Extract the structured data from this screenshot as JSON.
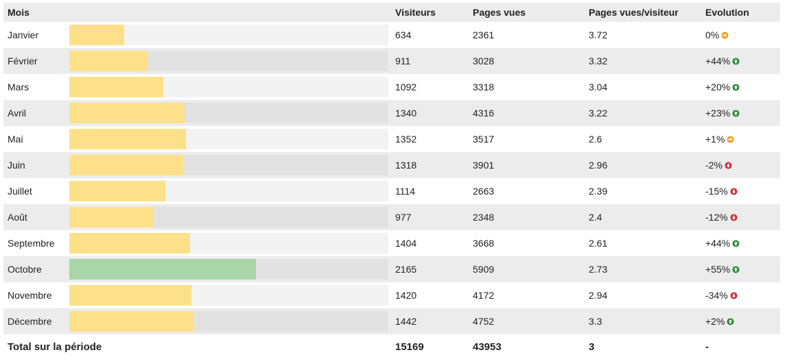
{
  "table": {
    "headers": {
      "month": "Mois",
      "visitors": "Visiteurs",
      "pages": "Pages vues",
      "pages_per_visitor": "Pages vues/visiteur",
      "evolution": "Evolution"
    },
    "rows": [
      {
        "month": "Janvier",
        "visitors": "634",
        "pages": "2361",
        "ppv": "3.72",
        "evolution": "0%",
        "trend": "flat"
      },
      {
        "month": "Février",
        "visitors": "911",
        "pages": "3028",
        "ppv": "3.32",
        "evolution": "+44%",
        "trend": "up"
      },
      {
        "month": "Mars",
        "visitors": "1092",
        "pages": "3318",
        "ppv": "3.04",
        "evolution": "+20%",
        "trend": "up"
      },
      {
        "month": "Avril",
        "visitors": "1340",
        "pages": "4316",
        "ppv": "3.22",
        "evolution": "+23%",
        "trend": "up"
      },
      {
        "month": "Mai",
        "visitors": "1352",
        "pages": "3517",
        "ppv": "2.6",
        "evolution": "+1%",
        "trend": "flat"
      },
      {
        "month": "Juin",
        "visitors": "1318",
        "pages": "3901",
        "ppv": "2.96",
        "evolution": "-2%",
        "trend": "down"
      },
      {
        "month": "Juillet",
        "visitors": "1114",
        "pages": "2663",
        "ppv": "2.39",
        "evolution": "-15%",
        "trend": "down"
      },
      {
        "month": "Août",
        "visitors": "977",
        "pages": "2348",
        "ppv": "2.4",
        "evolution": "-12%",
        "trend": "down"
      },
      {
        "month": "Septembre",
        "visitors": "1404",
        "pages": "3668",
        "ppv": "2.61",
        "evolution": "+44%",
        "trend": "up"
      },
      {
        "month": "Octobre",
        "visitors": "2165",
        "pages": "5909",
        "ppv": "2.73",
        "evolution": "+55%",
        "trend": "up"
      },
      {
        "month": "Novembre",
        "visitors": "1420",
        "pages": "4172",
        "ppv": "2.94",
        "evolution": "-34%",
        "trend": "down"
      },
      {
        "month": "Décembre",
        "visitors": "1442",
        "pages": "4752",
        "ppv": "3.3",
        "evolution": "+2%",
        "trend": "up"
      }
    ],
    "total": {
      "label": "Total sur la période",
      "visitors": "15169",
      "pages": "43953",
      "ppv": "3",
      "evolution": "-"
    }
  },
  "colors": {
    "bar": "#fde08a",
    "bar_max": "#a8d6a6",
    "trend_up": "#2e8b3a",
    "trend_flat": "#f0a020",
    "trend_down": "#d03030"
  },
  "bar_scale_max": 3700
}
